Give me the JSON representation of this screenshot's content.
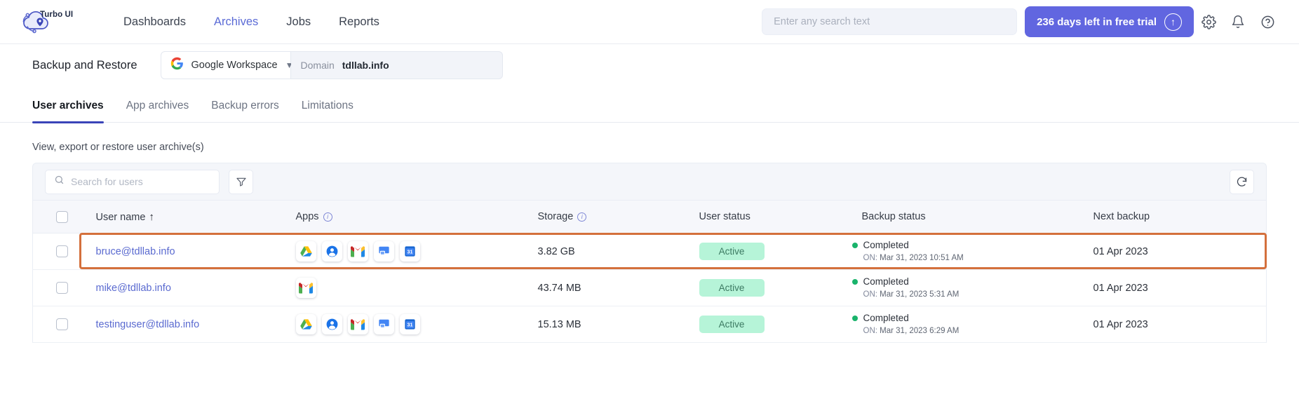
{
  "header": {
    "brand_name": "Turbo UI",
    "brand_logo_icon": "cloud-pin-logo",
    "nav": [
      {
        "label": "Dashboards",
        "active": false
      },
      {
        "label": "Archives",
        "active": true
      },
      {
        "label": "Jobs",
        "active": false
      },
      {
        "label": "Reports",
        "active": false
      }
    ],
    "search": {
      "value": "",
      "placeholder": "Enter any search text",
      "icon": "search-icon"
    },
    "trial": {
      "label": "236 days left in free trial",
      "icon": "upgrade-arrow-up-icon"
    },
    "actions": [
      {
        "name": "settings",
        "icon": "gear-icon"
      },
      {
        "name": "notifications",
        "icon": "bell-icon"
      },
      {
        "name": "help",
        "icon": "question-circle-icon"
      }
    ]
  },
  "subheader": {
    "page_title": "Backup and Restore",
    "workspace": {
      "label": "Google Workspace",
      "icon": "google-g-icon",
      "chevron": "chevron-down-icon"
    },
    "domain": {
      "key": "Domain",
      "value": "tdllab.info"
    }
  },
  "tabs": [
    {
      "label": "User archives",
      "active": true
    },
    {
      "label": "App archives",
      "active": false
    },
    {
      "label": "Backup errors",
      "active": false
    },
    {
      "label": "Limitations",
      "active": false
    }
  ],
  "section": {
    "caption": "View, export or restore user archive(s)",
    "user_search": {
      "value": "",
      "placeholder": "Search for users",
      "icon": "search-icon"
    },
    "filter_button_icon": "filter-funnel-icon",
    "refresh_button_icon": "refresh-icon"
  },
  "table": {
    "columns": [
      {
        "key": "checkbox",
        "label": "",
        "icon": "checkbox-icon"
      },
      {
        "key": "user",
        "label": "User name",
        "sort": "ascending",
        "sort_icon": "arrow-up-icon"
      },
      {
        "key": "apps",
        "label": "Apps",
        "info_icon": "info-circle-icon"
      },
      {
        "key": "storage",
        "label": "Storage",
        "info_icon": "info-circle-icon"
      },
      {
        "key": "user_status",
        "label": "User status"
      },
      {
        "key": "backup_status",
        "label": "Backup status"
      },
      {
        "key": "next_backup",
        "label": "Next backup"
      }
    ],
    "rows": [
      {
        "selected": false,
        "highlighted": true,
        "user": "bruce@tdllab.info",
        "apps": [
          "google-drive-icon",
          "google-contacts-icon",
          "gmail-icon",
          "google-chat-icon",
          "google-calendar-icon"
        ],
        "storage": "3.82 GB",
        "user_status": "Active",
        "backup_status": "Completed",
        "backup_on_key": "ON:",
        "backup_on": "Mar 31, 2023 10:51 AM",
        "next_backup": "01 Apr 2023"
      },
      {
        "selected": false,
        "highlighted": false,
        "user": "mike@tdllab.info",
        "apps": [
          "gmail-icon"
        ],
        "storage": "43.74 MB",
        "user_status": "Active",
        "backup_status": "Completed",
        "backup_on_key": "ON:",
        "backup_on": "Mar 31, 2023 5:31 AM",
        "next_backup": "01 Apr 2023"
      },
      {
        "selected": false,
        "highlighted": false,
        "user": "testinguser@tdllab.info",
        "apps": [
          "google-drive-icon",
          "google-contacts-icon",
          "gmail-icon",
          "google-chat-icon",
          "google-calendar-icon"
        ],
        "storage": "15.13 MB",
        "user_status": "Active",
        "backup_status": "Completed",
        "backup_on_key": "ON:",
        "backup_on": "Mar 31, 2023 6:29 AM",
        "next_backup": "01 Apr 2023"
      }
    ]
  },
  "colors": {
    "accent": "#5b6bd6",
    "trial_bg": "#6166e0",
    "tab_underline": "#3a44b8",
    "status_pill_bg": "#b6f4d8",
    "status_pill_text": "#3c7a62",
    "backup_dot": "#19b36b",
    "highlight_border": "#d4703c",
    "link": "#5a6ad0"
  }
}
